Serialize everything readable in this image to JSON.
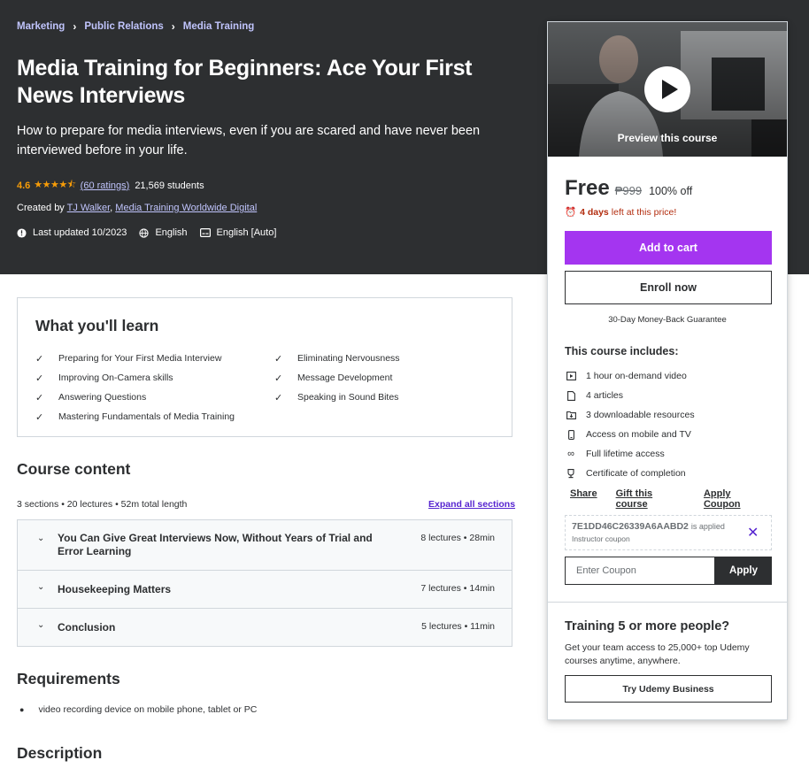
{
  "breadcrumb": [
    "Marketing",
    "Public Relations",
    "Media Training"
  ],
  "course": {
    "title": "Media Training for Beginners: Ace Your First News Interviews",
    "subtitle": "How to prepare for media interviews, even if you are scared and have never been interviewed before in your life.",
    "rating": "4.6",
    "rating_value": 4.6,
    "rating_count": "(60 ratings)",
    "students": "21,569 students",
    "created_by_label": "Created by",
    "authors": [
      "TJ Walker",
      "Media Training Worldwide Digital"
    ],
    "last_updated": "Last updated 10/2023",
    "language": "English",
    "captions": "English [Auto]"
  },
  "sidebar": {
    "preview_label": "Preview this course",
    "price": "Free",
    "original_price": "₱999",
    "discount": "100% off",
    "timer_days": "4 days",
    "timer_text": "left at this price!",
    "add_to_cart": "Add to cart",
    "enroll_now": "Enroll now",
    "guarantee": "30-Day Money-Back Guarantee",
    "includes_title": "This course includes:",
    "includes": [
      {
        "icon": "video-icon",
        "text": "1 hour on-demand video"
      },
      {
        "icon": "article-icon",
        "text": "4 articles"
      },
      {
        "icon": "download-icon",
        "text": "3 downloadable resources"
      },
      {
        "icon": "mobile-icon",
        "text": "Access on mobile and TV"
      },
      {
        "icon": "infinity-icon",
        "text": "Full lifetime access"
      },
      {
        "icon": "trophy-icon",
        "text": "Certificate of completion"
      }
    ],
    "links": [
      "Share",
      "Gift this course",
      "Apply Coupon"
    ],
    "coupon_code": "7E1DD46C26339A6AABD2",
    "coupon_applied": "is applied",
    "coupon_sub": "Instructor coupon",
    "coupon_placeholder": "Enter Coupon",
    "apply": "Apply",
    "business_title": "Training 5 or more people?",
    "business_desc": "Get your team access to 25,000+ top Udemy courses anytime, anywhere.",
    "business_button": "Try Udemy Business"
  },
  "learn": {
    "title": "What you'll learn",
    "items": [
      "Preparing for Your First Media Interview",
      "Eliminating Nervousness",
      "Improving On-Camera skills",
      "Message Development",
      "Answering Questions",
      "Speaking in Sound Bites",
      "Mastering Fundamentals of Media Training"
    ]
  },
  "content": {
    "title": "Course content",
    "meta": "3 sections • 20 lectures • 52m total length",
    "expand": "Expand all sections",
    "sections": [
      {
        "title": "You Can Give Great Interviews Now, Without Years of Trial and Error Learning",
        "info": "8 lectures • 28min"
      },
      {
        "title": "Housekeeping Matters",
        "info": "7 lectures • 14min"
      },
      {
        "title": "Conclusion",
        "info": "5 lectures • 11min"
      }
    ]
  },
  "requirements": {
    "title": "Requirements",
    "items": [
      "video recording device on mobile phone, tablet or PC"
    ]
  },
  "description": {
    "title": "Description"
  },
  "colors": {
    "header_bg": "#2d2f31",
    "accent_purple": "#a435f0",
    "link_purple": "#5624d0",
    "star_orange": "#f69c08",
    "timer_red": "#b32d0f",
    "breadcrumb_link": "#c0c4fc"
  }
}
